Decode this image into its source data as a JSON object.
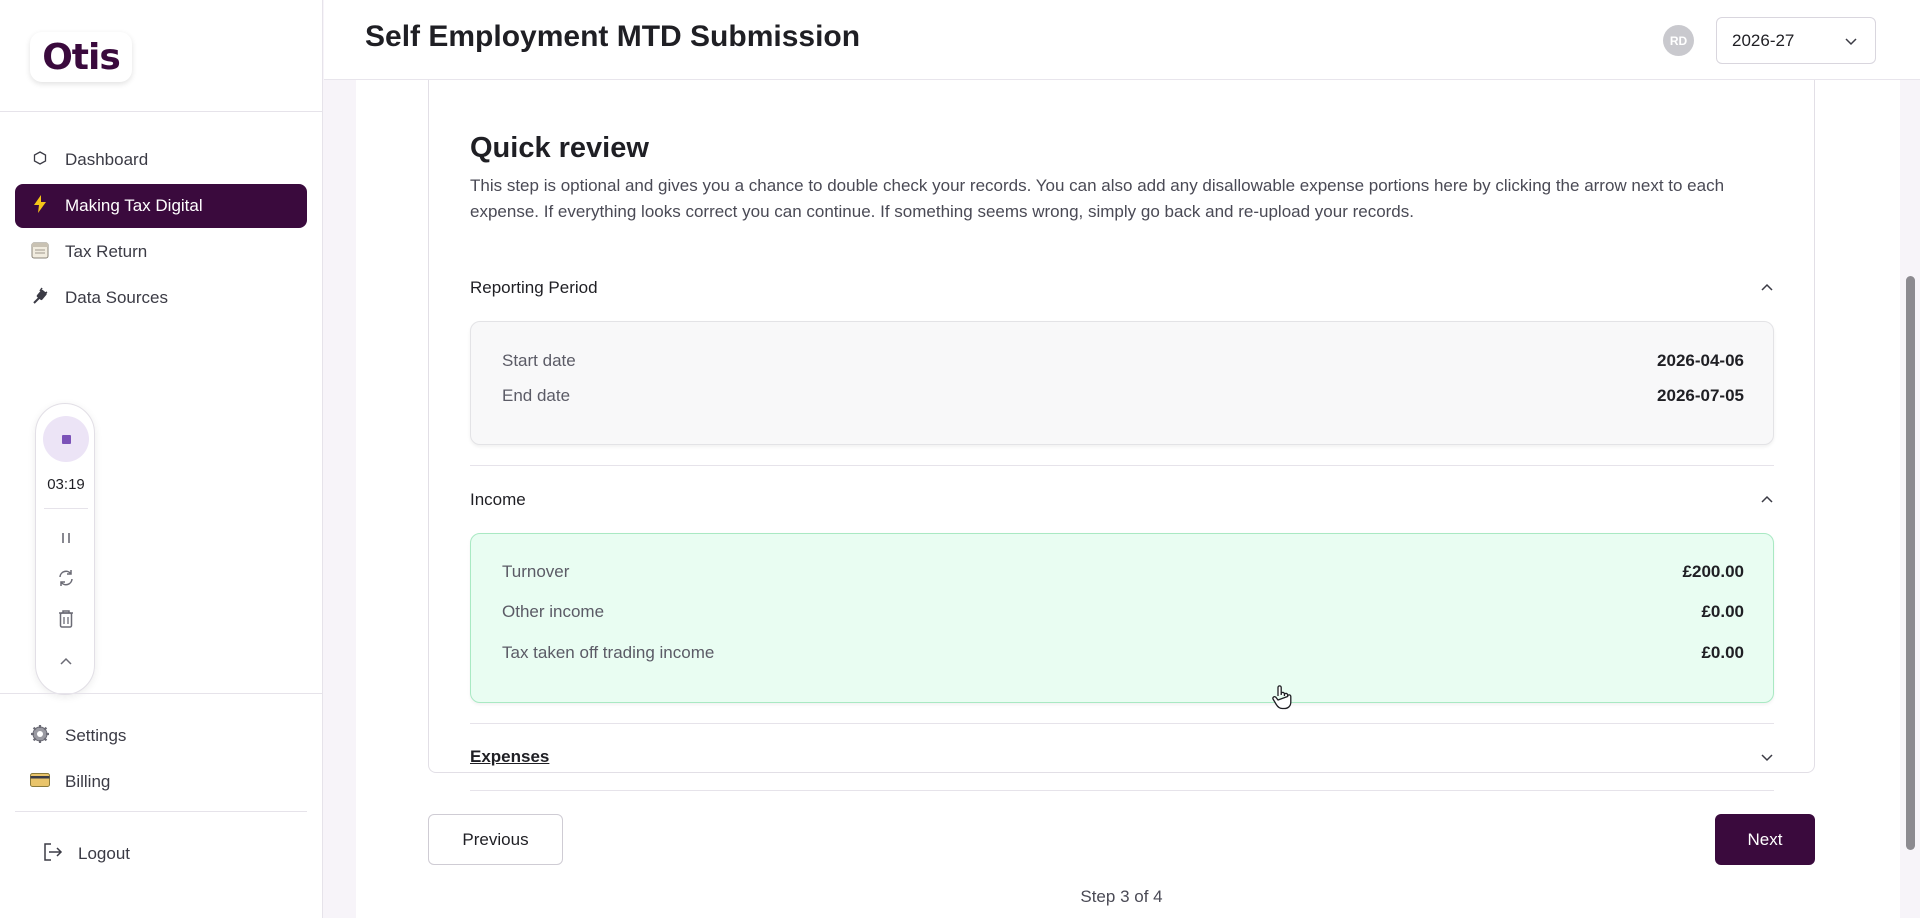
{
  "app": {
    "logo": "Otis"
  },
  "header": {
    "title": "Self Employment MTD Submission",
    "avatar_initials": "RD",
    "year_selected": "2026-27"
  },
  "sidebar": {
    "items": [
      {
        "label": "Dashboard",
        "icon": "hexagon-icon"
      },
      {
        "label": "Making Tax Digital",
        "icon": "lightning-icon",
        "active": true
      },
      {
        "label": "Tax Return",
        "icon": "calendar-icon"
      },
      {
        "label": "Data Sources",
        "icon": "plug-icon"
      }
    ],
    "bottom_items": [
      {
        "label": "Settings",
        "icon": "gear-icon"
      },
      {
        "label": "Billing",
        "icon": "credit-card-icon"
      }
    ],
    "logout_label": "Logout"
  },
  "recorder": {
    "time": "03:19"
  },
  "review": {
    "title": "Quick review",
    "description": "This step is optional and gives you a chance to double check your records. You can also add any disallowable expense portions here by clicking the arrow next to each expense. If everything looks correct you can continue. If something seems wrong, simply go back and re-upload your records.",
    "reporting_period": {
      "label": "Reporting Period",
      "start_label": "Start date",
      "start_value": "2026-04-06",
      "end_label": "End date",
      "end_value": "2026-07-05"
    },
    "income": {
      "label": "Income",
      "rows": [
        {
          "label": "Turnover",
          "value": "£200.00"
        },
        {
          "label": "Other income",
          "value": "£0.00"
        },
        {
          "label": "Tax taken off trading income",
          "value": "£0.00"
        }
      ]
    },
    "expenses": {
      "label": "Expenses"
    }
  },
  "nav": {
    "previous": "Previous",
    "next": "Next",
    "step": "Step 3 of 4"
  },
  "colors": {
    "brand": "#3a0a3d",
    "income_bg": "#e9fdf2",
    "income_border": "#a9e9c3"
  }
}
